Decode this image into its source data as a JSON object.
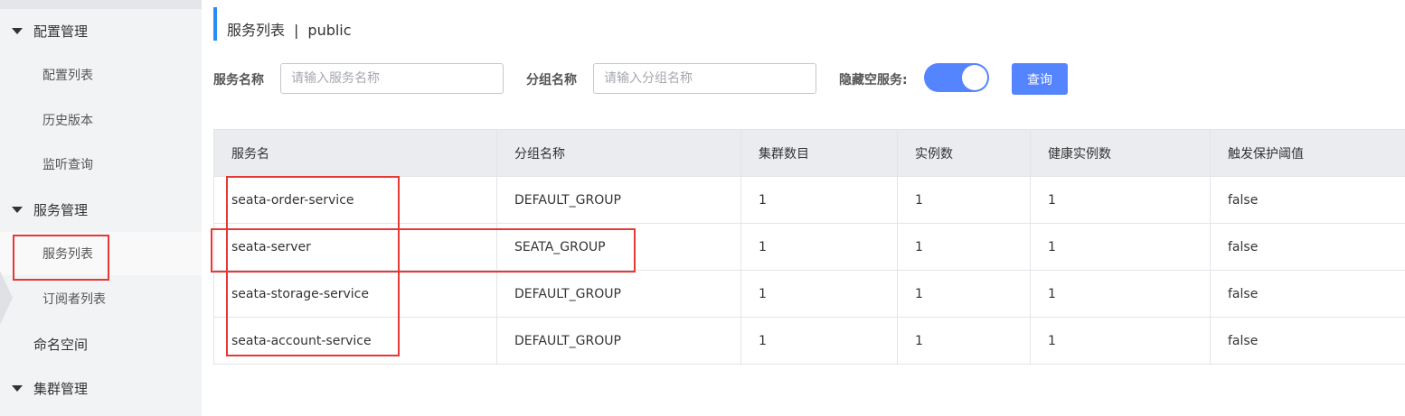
{
  "sidebar": {
    "groups": [
      {
        "label": "配置管理"
      },
      {
        "label": "服务管理"
      },
      {
        "label": "集群管理"
      }
    ],
    "items": [
      {
        "label": "配置列表"
      },
      {
        "label": "历史版本"
      },
      {
        "label": "监听查询"
      },
      {
        "label": "服务列表"
      },
      {
        "label": "订阅者列表"
      },
      {
        "label": "命名空间"
      }
    ]
  },
  "header": {
    "title": "服务列表",
    "separator": "|",
    "namespace": "public"
  },
  "filters": {
    "service_name_label": "服务名称",
    "service_name_placeholder": "请输入服务名称",
    "group_name_label": "分组名称",
    "group_name_placeholder": "请输入分组名称",
    "hide_empty_label": "隐藏空服务:",
    "hide_empty_on": true,
    "query_button": "查询"
  },
  "table": {
    "columns": [
      "服务名",
      "分组名称",
      "集群数目",
      "实例数",
      "健康实例数",
      "触发保护阈值"
    ],
    "rows": [
      [
        "seata-order-service",
        "DEFAULT_GROUP",
        "1",
        "1",
        "1",
        "false"
      ],
      [
        "seata-server",
        "SEATA_GROUP",
        "1",
        "1",
        "1",
        "false"
      ],
      [
        "seata-storage-service",
        "DEFAULT_GROUP",
        "1",
        "1",
        "1",
        "false"
      ],
      [
        "seata-account-service",
        "DEFAULT_GROUP",
        "1",
        "1",
        "1",
        "false"
      ]
    ]
  },
  "colors": {
    "accent": "#5584ff",
    "title_bar": "#2a8df7",
    "highlight": "#e53935"
  }
}
